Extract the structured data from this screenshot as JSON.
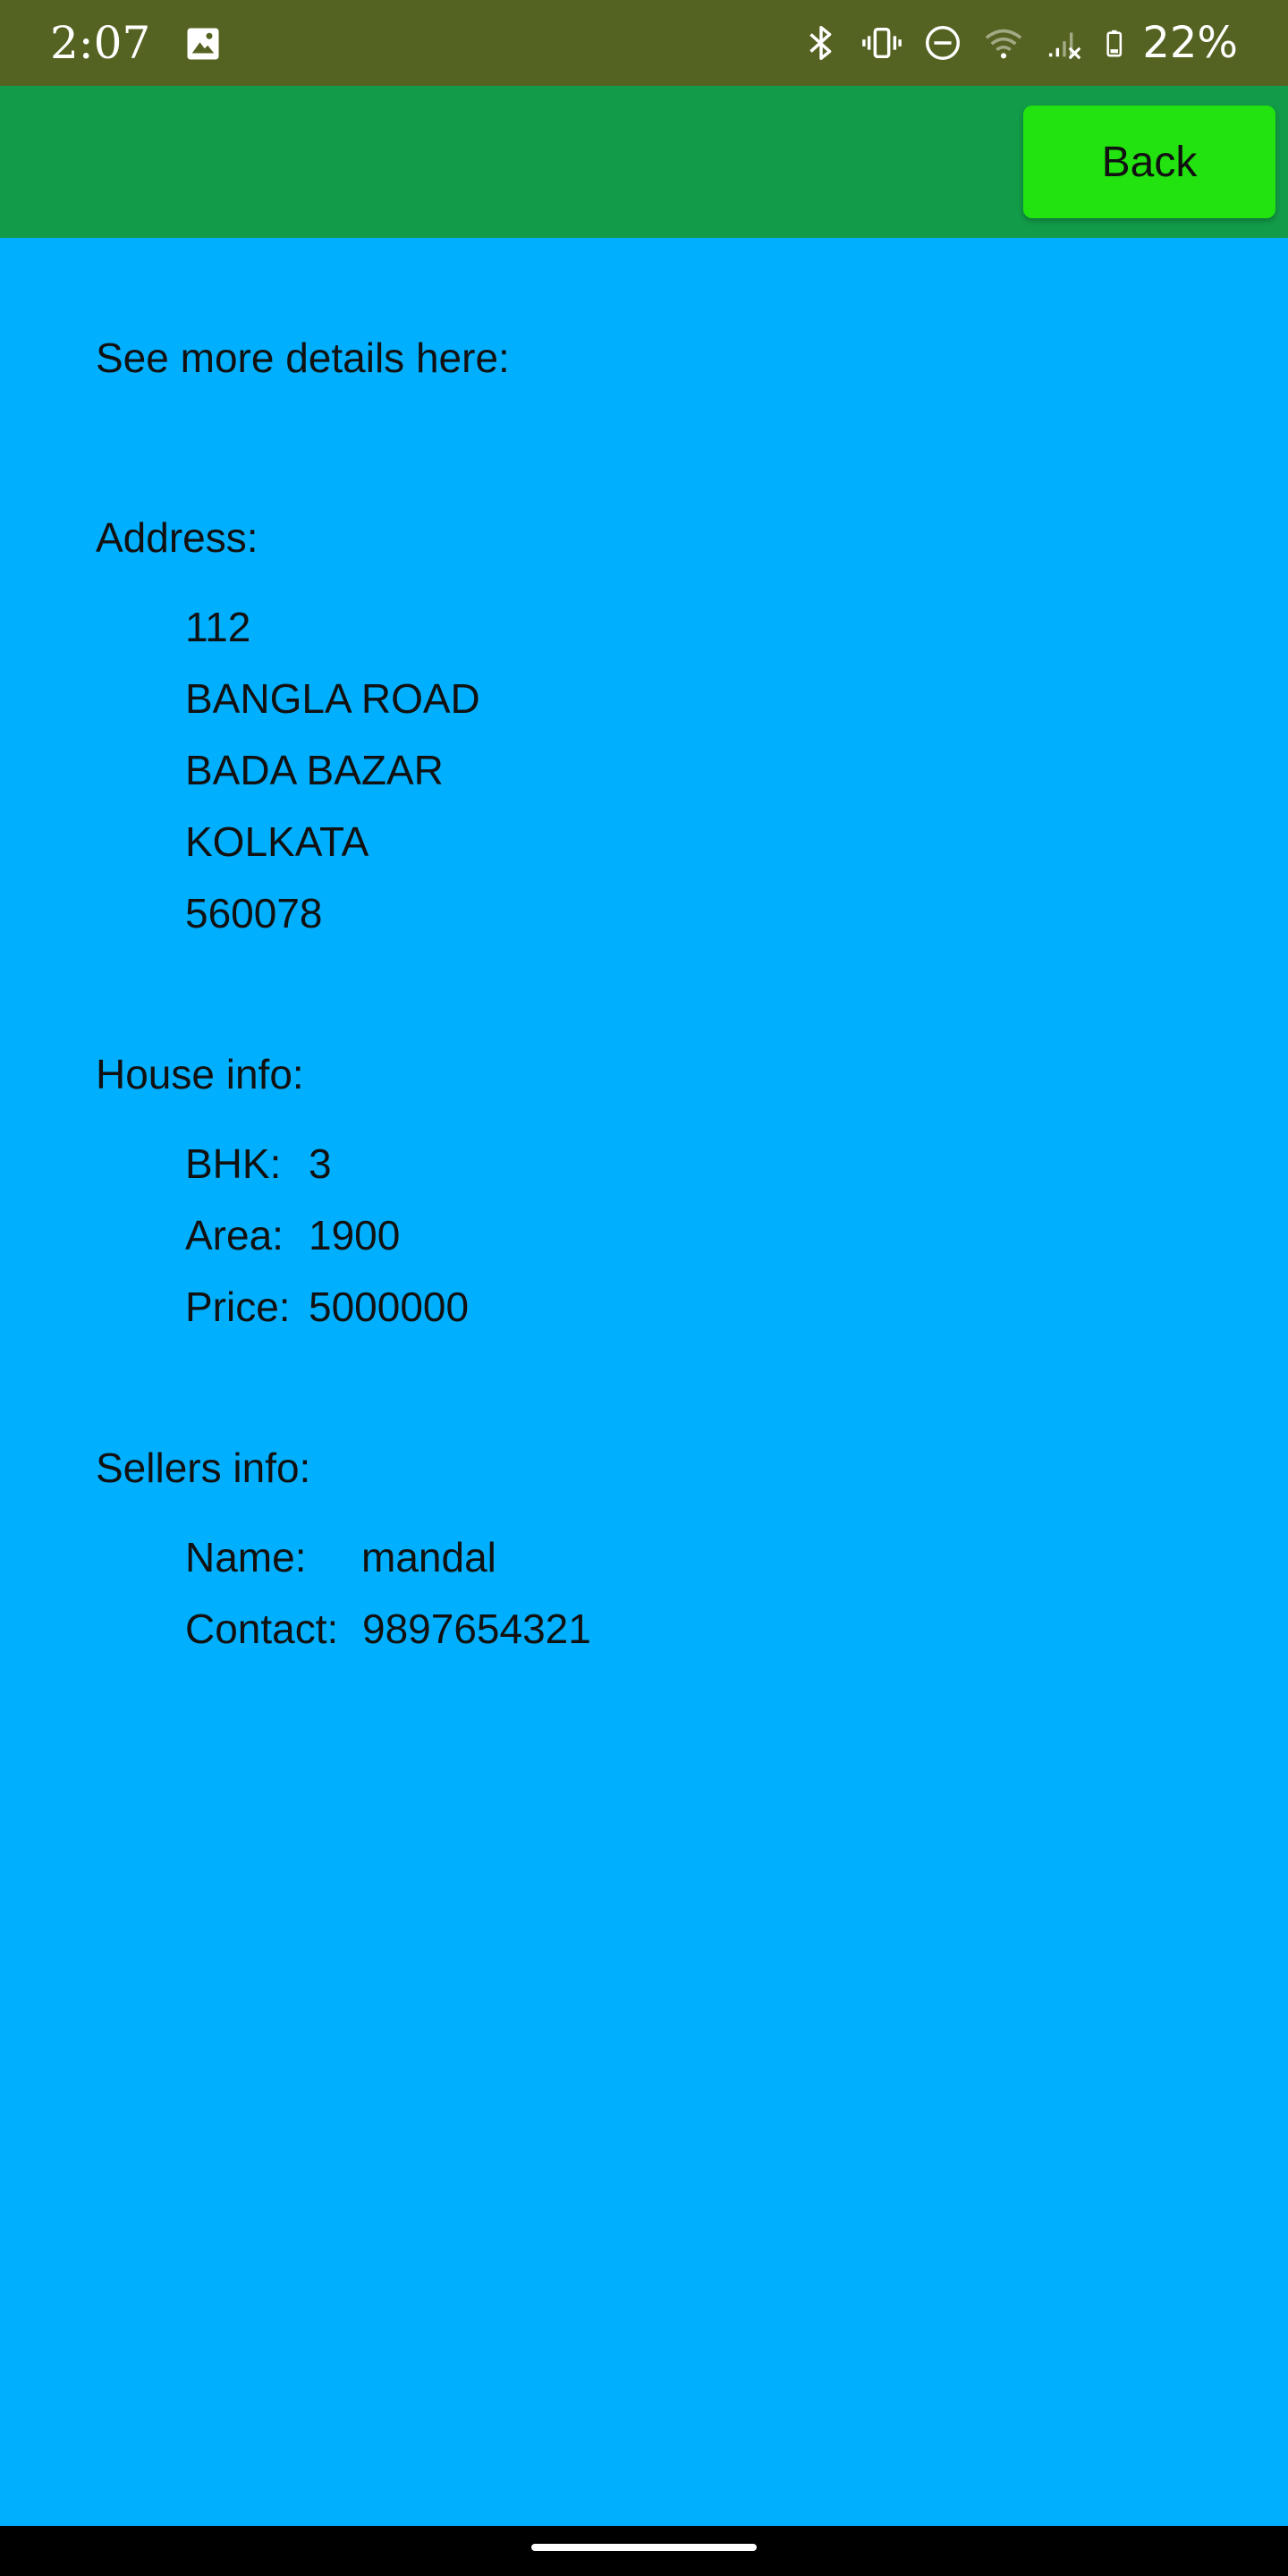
{
  "status_bar": {
    "time": "2:07",
    "battery": "22%",
    "icons": [
      "image-icon",
      "bluetooth-icon",
      "vibrate-icon",
      "do-not-disturb-icon",
      "wifi-icon",
      "signal-icon",
      "battery-icon"
    ]
  },
  "app_bar": {
    "back_label": "Back",
    "accent_color": "#22e30f",
    "background_color": "#129b48"
  },
  "content": {
    "intro": "See more details here:",
    "address": {
      "heading": "Address:",
      "lines": [
        "112",
        "BANGLA ROAD",
        "BADA BAZAR",
        "KOLKATA",
        "560078"
      ]
    },
    "house_info": {
      "heading": "House info:",
      "bhk_label": "BHK:",
      "bhk_value": "3",
      "area_label": "Area:",
      "area_value": "1900",
      "price_label": "Price:",
      "price_value": "5000000"
    },
    "sellers_info": {
      "heading": "Sellers info:",
      "name_label": "Name:",
      "name_value": "mandal",
      "contact_label": "Contact:",
      "contact_value": "9897654321"
    },
    "background_color": "#00b0ff"
  }
}
